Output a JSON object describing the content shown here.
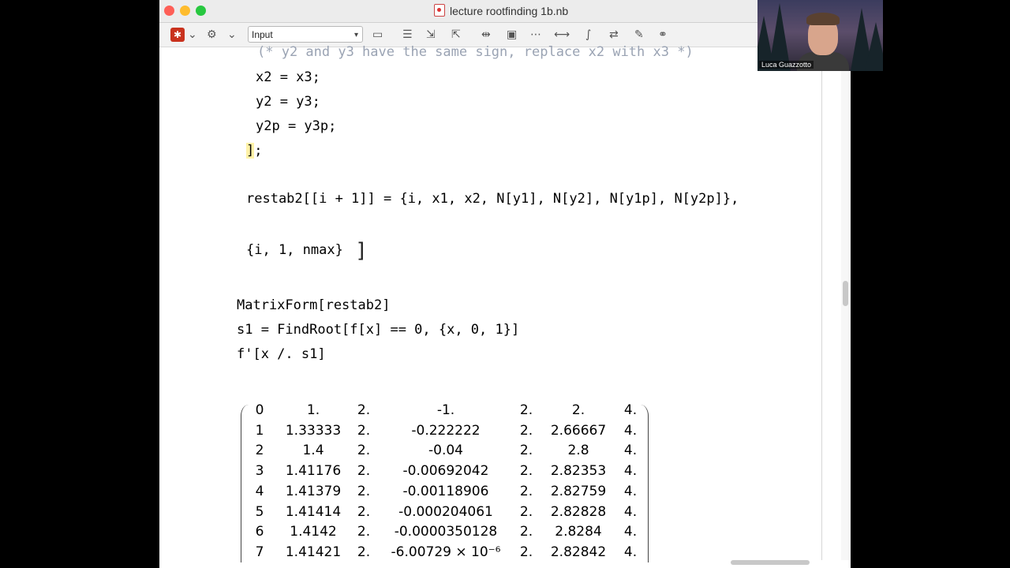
{
  "window": {
    "title": "lecture rootfinding 1b.nb"
  },
  "toolbar": {
    "style_select": "Input",
    "icons": [
      "wolfram-logo-icon",
      "gear-icon",
      "input-cell-icon",
      "cell-group-icon",
      "in-cell-icon",
      "out-cell-icon",
      "spacing-icon",
      "frame-icon",
      "ellipsis-icon",
      "grouping-icon",
      "typesetting-icon",
      "replace-icon",
      "pen-icon",
      "link-icon"
    ]
  },
  "code": {
    "line1": "(* y2 and y3 have the same sign, replace x2 with x3 *)",
    "line2": "x2 = x3;",
    "line3": "y2 = y3;",
    "line4": "y2p = y3p;",
    "line5a": "]",
    "line5b": ";",
    "line6": "restab2[[i + 1]] = {i, x1, x2, N[y1], N[y2], N[y1p], N[y2p]},",
    "line7": "{i, 1, nmax}",
    "line8": "MatrixForm[restab2]",
    "line9": "s1 = FindRoot[f[x] == 0, {x, 0, 1}]",
    "line10": "f'[x /. s1]"
  },
  "matrix": {
    "rows": [
      [
        "0",
        "1.",
        "2.",
        "-1.",
        "2.",
        "2.",
        "4."
      ],
      [
        "1",
        "1.33333",
        "2.",
        "-0.222222",
        "2.",
        "2.66667",
        "4."
      ],
      [
        "2",
        "1.4",
        "2.",
        "-0.04",
        "2.",
        "2.8",
        "4."
      ],
      [
        "3",
        "1.41176",
        "2.",
        "-0.00692042",
        "2.",
        "2.82353",
        "4."
      ],
      [
        "4",
        "1.41379",
        "2.",
        "-0.00118906",
        "2.",
        "2.82759",
        "4."
      ],
      [
        "5",
        "1.41414",
        "2.",
        "-0.000204061",
        "2.",
        "2.82828",
        "4."
      ],
      [
        "6",
        "1.4142",
        "2.",
        "-0.0000350128",
        "2.",
        "2.8284",
        "4."
      ],
      [
        "7",
        "1.41421",
        "2.",
        "-6.00729 × 10⁻⁶",
        "2.",
        "2.82842",
        "4."
      ]
    ]
  },
  "video": {
    "participant_name": "Luca Guazzotto"
  }
}
